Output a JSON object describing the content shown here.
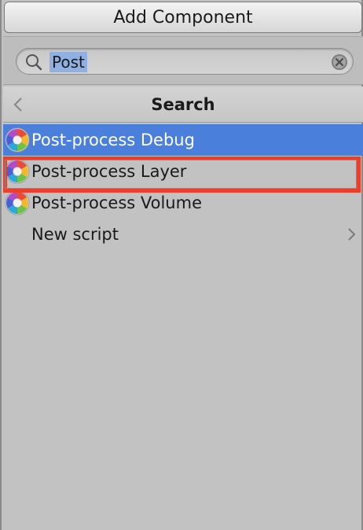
{
  "window": {
    "title": "Add Component"
  },
  "search": {
    "value": "Post",
    "search_icon": "magnifier-icon",
    "clear_icon": "clear-circle-icon"
  },
  "header": {
    "title": "Search",
    "back_icon": "chevron-left-icon"
  },
  "list": {
    "items": [
      {
        "label": "Post-process Debug",
        "icon": "post-process-aperture-icon",
        "selected": true
      },
      {
        "label": "Post-process Layer",
        "icon": "post-process-aperture-icon",
        "selected": false,
        "highlighted": true
      },
      {
        "label": "Post-process Volume",
        "icon": "post-process-aperture-icon",
        "selected": false
      },
      {
        "label": "New script",
        "icon": "",
        "selected": false,
        "has_submenu": true
      }
    ]
  },
  "colors": {
    "selection": "#4a7fdc",
    "highlight_border": "#e8402c",
    "background": "#c2c2c2",
    "search_selection": "#8fb0e0"
  }
}
